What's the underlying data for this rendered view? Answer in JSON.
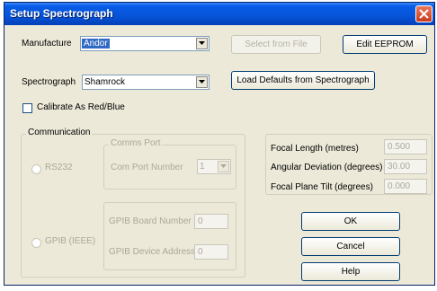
{
  "title": "Setup Spectrograph",
  "manufacturer": {
    "label": "Manufacture",
    "value": "Andor"
  },
  "spectrograph": {
    "label": "Spectrograph",
    "value": "Shamrock"
  },
  "buttons": {
    "select_from_file": "Select from File",
    "edit_eeprom": "Edit EEPROM",
    "load_defaults": "Load Defaults from Spectrograph",
    "ok": "OK",
    "cancel": "Cancel",
    "help": "Help"
  },
  "calibrate": {
    "label": "Calibrate As Red/Blue",
    "checked": false
  },
  "communication": {
    "label": "Communication",
    "rs232": {
      "label": "RS232",
      "selected": false
    },
    "com_group_label": "Comms Port",
    "com_port_label": "Com Port Number",
    "com_port_value": "1",
    "gpib": {
      "label": "GPIB (IEEE)",
      "selected": false
    },
    "board_number_label": "GPIB Board Number",
    "board_number_value": "0",
    "device_address_label": "GPIB Device Address",
    "device_address_value": "0"
  },
  "focal": {
    "length_label": "Focal Length (metres)",
    "length_value": "0.500",
    "deviation_label": "Angular Deviation (degrees)",
    "deviation_value": "30.00",
    "tilt_label": "Focal Plane Tilt (degrees)",
    "tilt_value": "0.000"
  }
}
